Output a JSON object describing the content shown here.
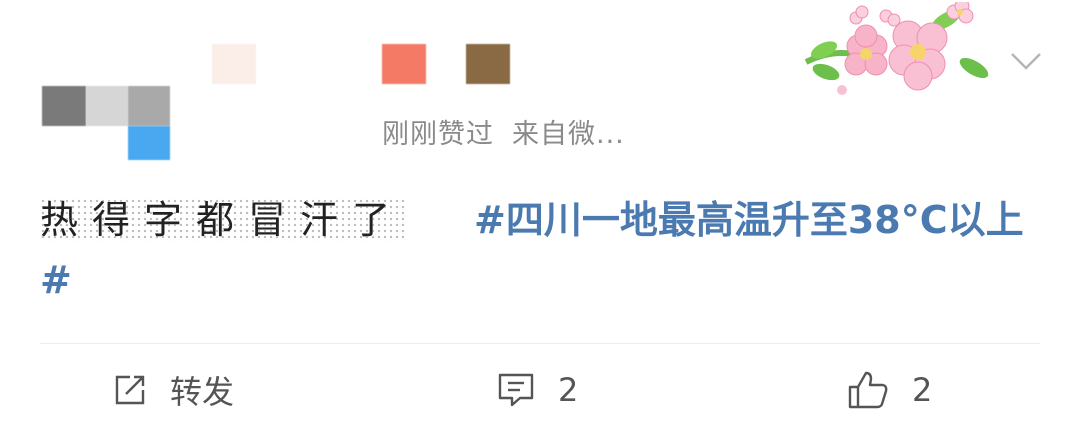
{
  "post": {
    "meta_time": "刚刚赞过",
    "meta_source": "来自微...",
    "text": "热得字都冒汗了",
    "topic": "#四川一地最高温升至38°C以上#"
  },
  "actions": {
    "repost_label": "转发",
    "comment_count": "2",
    "like_count": "2"
  },
  "icons": {
    "decoration": "cherry-blossom-icon",
    "more": "chevron-down-icon",
    "repost": "repost-icon",
    "comment": "comment-icon",
    "like": "thumbs-up-icon"
  },
  "colors": {
    "topic": "#4a7ab0",
    "meta": "#8a8a8a",
    "text": "#222222"
  }
}
